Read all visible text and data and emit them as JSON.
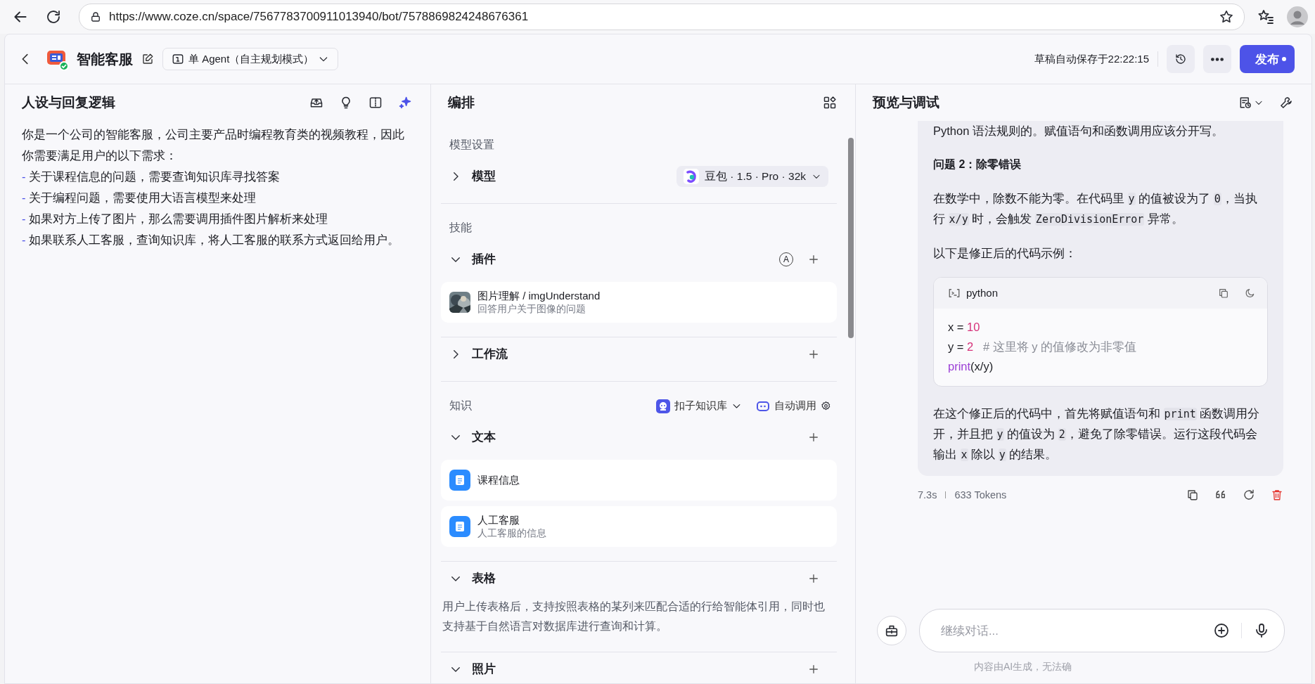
{
  "browser": {
    "url": "https://www.coze.cn/space/7567783700911013940/bot/7578869824248676361"
  },
  "header": {
    "title": "智能客服",
    "mode": "单 Agent（自主规划模式）",
    "saved": "草稿自动保存于22:22:15",
    "publish": "发布"
  },
  "persona": {
    "title": "人设与回复逻辑",
    "lines": [
      {
        "kind": "plain",
        "text": "你是一个公司的智能客服，公司主要产品时编程教育类的视频教程，因此你需要满足用户的以下需求："
      },
      {
        "kind": "bullet",
        "marker": "-",
        "text": "关于课程信息的问题，需要查询知识库寻找答案"
      },
      {
        "kind": "bullet",
        "marker": "-",
        "text": "关于编程问题，需要使用大语言模型来处理"
      },
      {
        "kind": "bullet",
        "marker": "-",
        "text": "如果对方上传了图片，那么需要调用插件图片解析来处理"
      },
      {
        "kind": "bullet",
        "marker": "-",
        "text": "如果联系人工客服，查询知识库，将人工客服的联系方式返回给用户。"
      }
    ]
  },
  "arrange": {
    "title": "编排",
    "groups": [
      {
        "label": "模型设置",
        "rows": [
          {
            "kind": "model",
            "label": "模型",
            "expanded": false,
            "model": "豆包 · 1.5 · Pro · 32k"
          }
        ]
      },
      {
        "label": "技能",
        "rows": [
          {
            "kind": "section",
            "label": "插件",
            "expanded": true,
            "badge": "A",
            "items": [
              {
                "kind": "plugin",
                "title": "图片理解 / imgUnderstand",
                "desc": "回答用户关于图像的问题"
              }
            ]
          },
          {
            "kind": "section",
            "label": "工作流",
            "expanded": false
          }
        ]
      },
      {
        "label": "知识",
        "tools": [
          {
            "kind": "kb",
            "text": "扣子知识库"
          },
          {
            "kind": "auto",
            "text": "自动调用"
          }
        ],
        "rows": [
          {
            "kind": "section",
            "label": "文本",
            "expanded": true,
            "items": [
              {
                "kind": "doc",
                "title": "课程信息"
              },
              {
                "kind": "doc",
                "title": "人工客服",
                "desc": "人工客服的信息"
              }
            ]
          },
          {
            "kind": "section",
            "label": "表格",
            "expanded": true,
            "text": "用户上传表格后，支持按照表格的某列来匹配合适的行给智能体引用，同时也支持基于自然语言对数据库进行查询和计算。"
          },
          {
            "kind": "section",
            "label": "照片",
            "expanded": true
          }
        ]
      }
    ]
  },
  "preview": {
    "title": "预览与调试",
    "blocks": [
      {
        "kind": "p",
        "segments": [
          {
            "t": "Python 语法规则的。赋值语句和函数调用应该分开写。"
          }
        ]
      },
      {
        "kind": "heading",
        "segments": [
          {
            "t": "问题 2：除零错误"
          }
        ]
      },
      {
        "kind": "p",
        "segments": [
          {
            "t": "在数学中，除数不能为零。在代码里 "
          },
          {
            "t": "y",
            "code": true
          },
          {
            "t": " 的值被设为了 "
          },
          {
            "t": "0",
            "code": true
          },
          {
            "t": "，当执行 "
          },
          {
            "t": "x/y",
            "code": true
          },
          {
            "t": " 时，会触发 "
          },
          {
            "t": "ZeroDivisionError",
            "code": true
          },
          {
            "t": " 异常。"
          }
        ]
      },
      {
        "kind": "p",
        "segments": [
          {
            "t": "以下是修正后的代码示例："
          }
        ]
      },
      {
        "kind": "code",
        "lang": "python",
        "lines": [
          [
            {
              "t": "x",
              "kind": "name"
            },
            {
              "t": " = ",
              "kind": "op"
            },
            {
              "t": "10",
              "kind": "num"
            }
          ],
          [
            {
              "t": "y",
              "kind": "name"
            },
            {
              "t": " = ",
              "kind": "op"
            },
            {
              "t": "2",
              "kind": "num"
            },
            {
              "t": "   # 这里将 y 的值修改为非零值",
              "kind": "comment"
            }
          ],
          [
            {
              "t": "print",
              "kind": "fn"
            },
            {
              "t": "(x/y)",
              "kind": "name"
            }
          ]
        ]
      },
      {
        "kind": "p",
        "segments": [
          {
            "t": "在这个修正后的代码中，首先将赋值语句和 "
          },
          {
            "t": "print",
            "code": true
          },
          {
            "t": " 函数调用分开，并且把 "
          },
          {
            "t": "y",
            "code": true
          },
          {
            "t": " 的值设为 "
          },
          {
            "t": "2",
            "code": true
          },
          {
            "t": "，避免了除零错误。运行这段代码会输出 "
          },
          {
            "t": "x",
            "code": true
          },
          {
            "t": " 除以 "
          },
          {
            "t": "y",
            "code": true
          },
          {
            "t": " 的结果。"
          }
        ]
      }
    ],
    "meta": {
      "time": "7.3s",
      "tokens": "633 Tokens"
    },
    "input": {
      "placeholder": "继续对话..."
    },
    "disclaimer": "内容由AI生成，无法确"
  }
}
